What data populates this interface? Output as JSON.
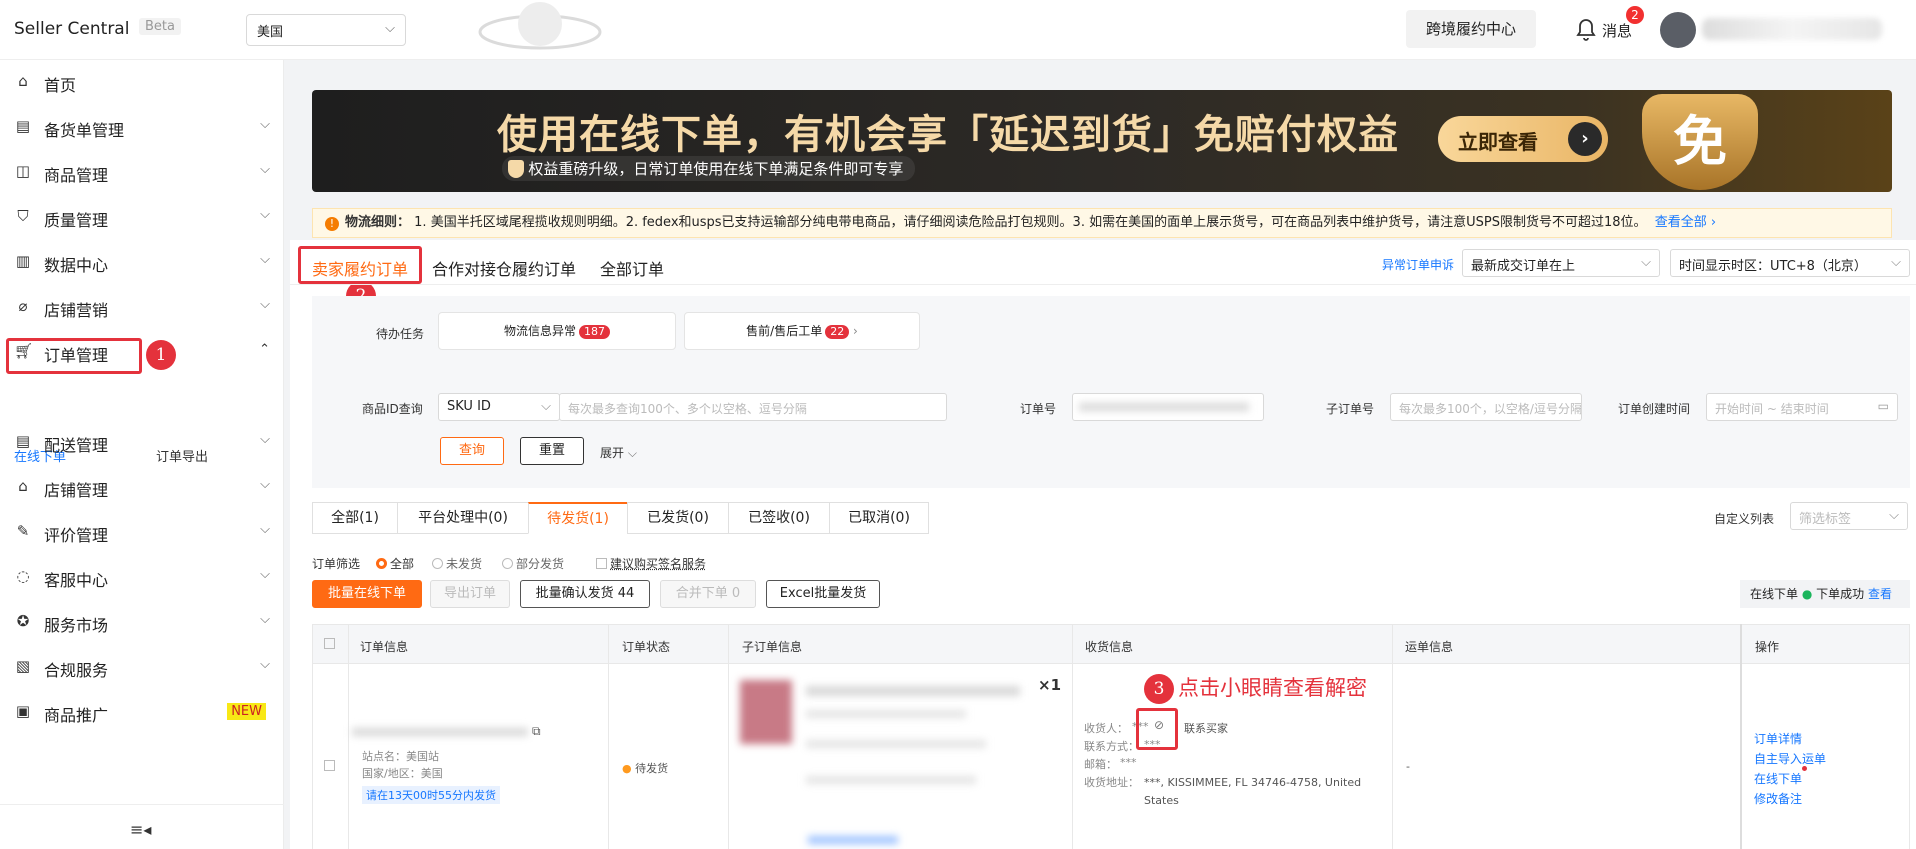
{
  "header": {
    "brand": "Seller Central",
    "beta": "Beta",
    "region": "美国",
    "cross_border_button": "跨境履约中心",
    "messages_label": "消息",
    "messages_count": "2"
  },
  "sidebar": {
    "items": [
      {
        "label": "首页",
        "icon": "home-icon"
      },
      {
        "label": "备货单管理",
        "icon": "clipboard-icon"
      },
      {
        "label": "商品管理",
        "icon": "box-icon"
      },
      {
        "label": "质量管理",
        "icon": "shield-check-icon"
      },
      {
        "label": "数据中心",
        "icon": "chart-icon"
      },
      {
        "label": "店铺营销",
        "icon": "tag-icon"
      },
      {
        "label": "订单管理",
        "icon": "cart-icon"
      },
      {
        "label": "配送管理",
        "icon": "delivery-icon"
      },
      {
        "label": "店铺管理",
        "icon": "store-icon"
      },
      {
        "label": "评价管理",
        "icon": "review-icon"
      },
      {
        "label": "客服中心",
        "icon": "chat-icon"
      },
      {
        "label": "服务市场",
        "icon": "star-icon"
      },
      {
        "label": "合规服务",
        "icon": "document-icon"
      },
      {
        "label": "商品推广",
        "icon": "ad-icon"
      }
    ],
    "new_tag": "NEW",
    "order_sub": [
      "在线下单",
      "订单导出"
    ]
  },
  "banner": {
    "headline": "使用在线下单，有机会享「延迟到货」免赔付权益",
    "subline": "权益重磅升级，日常订单使用在线下单满足条件即可专享",
    "cta": "立即查看",
    "emblem": "免"
  },
  "notice": {
    "title": "物流细则：",
    "text": "1. 美国半托区域尾程揽收规则明细。2. fedex和usps已支持运输部分纯电带电商品，请仔细阅读危险品打包规则。3. 如需在美国的面单上展示货号，可在商品列表中维护货号，请注意USPS限制货号不可超过18位。",
    "link": "查看全部"
  },
  "tabs": [
    "卖家履约订单",
    "合作对接仓履约订单",
    "全部订单"
  ],
  "top_right": {
    "appeal_link": "异常订单申诉",
    "sort": "最新成交订单在上",
    "timezone": "时间显示时区：UTC+8（北京）"
  },
  "filter": {
    "todo_label": "待办任务",
    "card1": "物流信息异常",
    "card1_count": "187",
    "card2": "售前/售后工单",
    "card2_count": "22",
    "product_id_label": "商品ID查询",
    "sku_select": "SKU ID",
    "sku_placeholder": "每次最多查询100个、多个以空格、逗号分隔",
    "order_no_label": "订单号",
    "sub_order_label": "子订单号",
    "sub_order_placeholder": "每次最多100个，以空格/逗号分隔",
    "create_time_label": "订单创建时间",
    "start_placeholder": "开始时间",
    "tilde": "~",
    "end_placeholder": "结束时间",
    "query": "查询",
    "reset": "重置",
    "expand": "展开"
  },
  "status_tabs": [
    "全部(1)",
    "平台处理中(0)",
    "待发货(1)",
    "已发货(0)",
    "已签收(0)",
    "已取消(0)"
  ],
  "custom_list": "自定义列表",
  "tag_filter_placeholder": "筛选标签",
  "order_filter": {
    "label": "订单筛选",
    "options": [
      "全部",
      "未发货",
      "部分发货"
    ],
    "checkbox": "建议购买签名服务"
  },
  "actions": {
    "bulk_online": "批量在线下单",
    "export": "导出订单",
    "bulk_confirm": "批量确认发货 44",
    "merge": "合并下单 0",
    "excel": "Excel批量发货"
  },
  "online_status": {
    "label": "在线下单",
    "success": "下单成功",
    "view": "查看"
  },
  "table": {
    "headers": [
      "订单信息",
      "订单状态",
      "子订单信息",
      "收货信息",
      "运单信息",
      "操作"
    ],
    "row": {
      "site": "站点名：美国站",
      "region": "国家/地区：美国",
      "ship_deadline": "请在13天00时55分内发货",
      "status": "待发货",
      "qty": "×1",
      "recipient": "收货人：",
      "contact_buyer": "联系买家",
      "phone": "联系方式：",
      "masked": "***",
      "email": "邮箱：",
      "address_label": "收货地址：",
      "address": "***, KISSIMMEE, FL 34746-4758, United States",
      "waybill": "-",
      "ops": [
        "订单详情",
        "自主导入运单",
        "在线下单",
        "修改备注"
      ]
    }
  },
  "annotations": {
    "one": "1",
    "two": "2",
    "three": "3",
    "three_text": "点击小眼睛查看解密"
  },
  "colors": {
    "accent": "#ff6a13",
    "annotation": "#e4323c",
    "link": "#1677ff"
  }
}
